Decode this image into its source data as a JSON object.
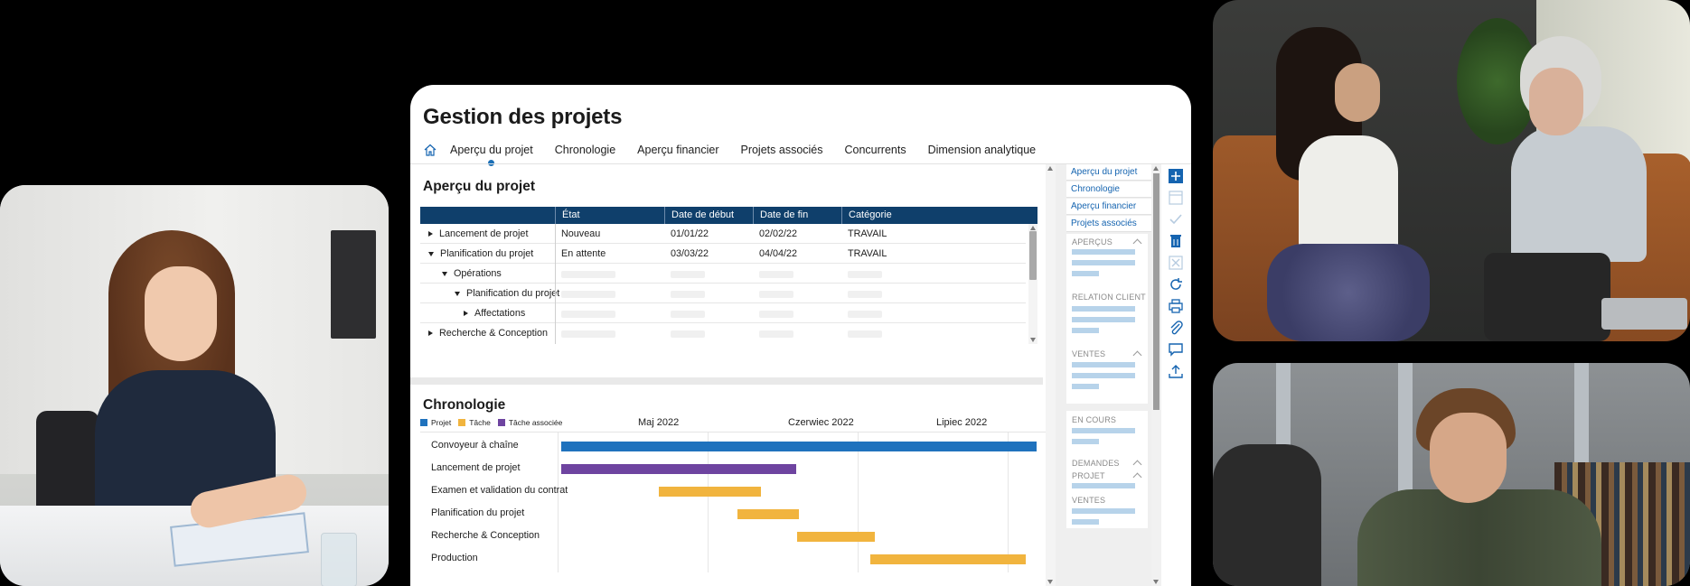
{
  "app": {
    "title": "Gestion des projets",
    "tabs": [
      {
        "label": "Aperçu du projet",
        "active": true
      },
      {
        "label": "Chronologie",
        "active": false
      },
      {
        "label": "Aperçu financier",
        "active": false
      },
      {
        "label": "Projets associés",
        "active": false
      },
      {
        "label": "Concurrents",
        "active": false
      },
      {
        "label": "Dimension analytique",
        "active": false
      }
    ]
  },
  "overview": {
    "title": "Aperçu du projet",
    "columns": [
      "État",
      "Date de début",
      "Date de fin",
      "Catégorie"
    ],
    "rows": [
      {
        "name": "Lancement de projet",
        "expanded": false,
        "level": 0,
        "state": "Nouveau",
        "start": "01/01/22",
        "end": "02/02/22",
        "category": "TRAVAIL"
      },
      {
        "name": "Planification du projet",
        "expanded": true,
        "level": 0,
        "state": "En attente",
        "start": "03/03/22",
        "end": "04/04/22",
        "category": "TRAVAIL"
      },
      {
        "name": "Opérations",
        "expanded": true,
        "level": 1,
        "state": "",
        "start": "",
        "end": "",
        "category": ""
      },
      {
        "name": "Planification du projet",
        "expanded": true,
        "level": 2,
        "state": "",
        "start": "",
        "end": "",
        "category": ""
      },
      {
        "name": "Affectations",
        "expanded": false,
        "level": 3,
        "state": "",
        "start": "",
        "end": "",
        "category": ""
      },
      {
        "name": "Recherche & Conception",
        "expanded": false,
        "level": 0,
        "state": "",
        "start": "",
        "end": "",
        "category": ""
      }
    ]
  },
  "timeline": {
    "title": "Chronologie",
    "legend": [
      {
        "label": "Projet",
        "color": "#1f72bd"
      },
      {
        "label": "Tâche",
        "color": "#f1b43e"
      },
      {
        "label": "Tâche associée",
        "color": "#6e44a0"
      }
    ],
    "months": [
      "Maj 2022",
      "Czerwiec 2022",
      "Lipiec 2022"
    ],
    "tasks": [
      {
        "label": "Convoyeur à chaîne",
        "type": "Projet",
        "start": 0.0,
        "end": 1.0
      },
      {
        "label": "Lancement de projet",
        "type": "Tâche associée",
        "start": 0.0,
        "end": 0.495
      },
      {
        "label": "Examen et validation du contrat",
        "type": "Tâche",
        "start": 0.205,
        "end": 0.42
      },
      {
        "label": "Planification du projet",
        "type": "Tâche",
        "start": 0.37,
        "end": 0.5
      },
      {
        "label": "Recherche & Conception",
        "type": "Tâche",
        "start": 0.497,
        "end": 0.66
      },
      {
        "label": "Production",
        "type": "Tâche",
        "start": 0.65,
        "end": 0.978
      }
    ]
  },
  "side_panel": {
    "links": [
      "Aperçu du projet",
      "Chronologie",
      "Aperçu financier",
      "Projets associés"
    ],
    "sections": [
      {
        "heading": "APERÇUS",
        "collapsible": true
      },
      {
        "heading": "RELATION CLIENT",
        "collapsible": false
      },
      {
        "heading": "VENTES",
        "collapsible": true
      },
      {
        "heading": "EN COURS",
        "collapsible": false
      },
      {
        "heading": "DEMANDES",
        "collapsible": true
      },
      {
        "heading": "PROJET",
        "collapsible": true
      },
      {
        "heading": "VENTES",
        "collapsible": false
      }
    ]
  },
  "toolbar": {
    "icons": [
      "add-icon",
      "window-icon",
      "check-icon",
      "delete-icon",
      "close-icon",
      "refresh-icon",
      "print-icon",
      "attach-icon",
      "comment-icon",
      "upload-icon"
    ]
  },
  "colors": {
    "header_blue": "#0f3f6b",
    "accent_blue": "#1564b0",
    "project_bar": "#1f72bd",
    "task_bar": "#f1b43e",
    "related_bar": "#6e44a0"
  }
}
